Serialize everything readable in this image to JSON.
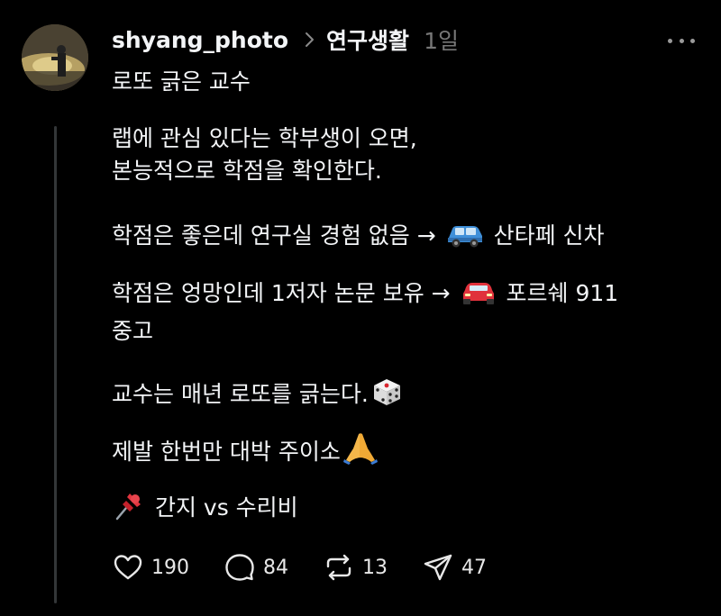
{
  "post": {
    "username": "shyang_photo",
    "topic": "연구생활",
    "time": "1일",
    "title": "로또 긁은 교수",
    "lines": {
      "p1a": "랩에 관심 있다는 학부생이 오면,",
      "p1b": "본능적으로 학점을 확인한다.",
      "p2a": "학점은 좋은데 연구실 경험 없음 → ",
      "p2b": " 산타페 신차",
      "p3a": "학점은 엉망인데 1저자 논문 보유 → ",
      "p3b": " 포르쉐 911",
      "p3c": "중고",
      "p4": "교수는 매년 로또를 긁는다.",
      "p5": "제발 한번만 대박 주이소",
      "p6": " 간지 vs 수리비"
    },
    "emoji": {
      "suv": "blue-suv-emoji",
      "car": "red-car-emoji",
      "dice": "dice-emoji",
      "pray": "folded-hands-emoji",
      "pin": "pushpin-emoji"
    }
  },
  "actions": {
    "likes": "190",
    "comments": "84",
    "reposts": "13",
    "shares": "47"
  },
  "colors": {
    "background": "#000000",
    "text": "#f3f5f7",
    "muted": "#777777",
    "thread_line": "#333638"
  }
}
